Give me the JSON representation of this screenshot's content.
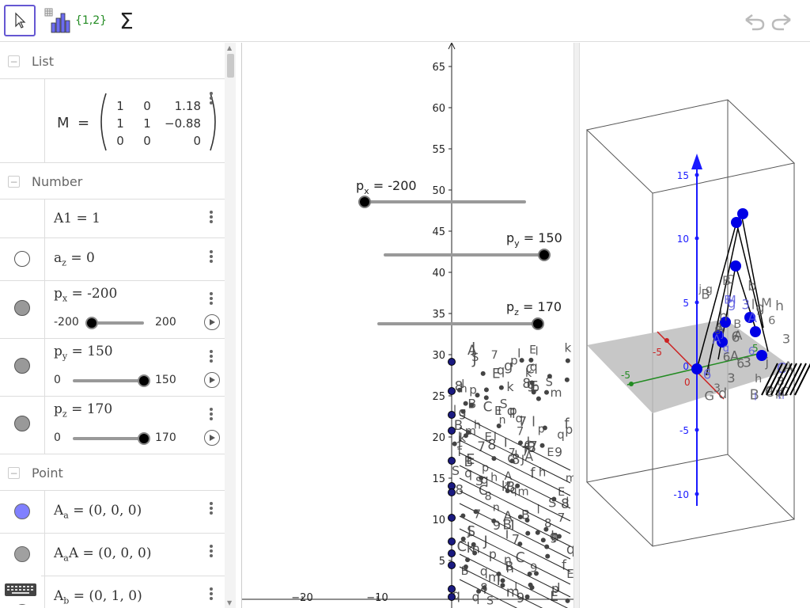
{
  "toolbar": {
    "tools": [
      {
        "name": "move-tool",
        "icon": "pointer-arrow-icon"
      },
      {
        "name": "statistics-tool",
        "icon": "bar-chart-icon"
      },
      {
        "name": "list-tool",
        "label": "{1,2}"
      },
      {
        "name": "sum-tool",
        "label": "Σ"
      }
    ],
    "undo_icon": "undo-icon",
    "redo_icon": "redo-icon"
  },
  "algebra": {
    "categories": {
      "list": "List",
      "number": "Number",
      "point": "Point"
    },
    "matrix": {
      "name": "M",
      "eq": "=",
      "rows": [
        [
          "1",
          "0",
          "1.18"
        ],
        [
          "1",
          "1",
          "−0.88"
        ],
        [
          "0",
          "0",
          "0"
        ]
      ]
    },
    "a1": "A1 = 1",
    "az": {
      "base": "a",
      "sub": "z",
      "rest": " = 0"
    },
    "sliders": [
      {
        "base": "p",
        "sub": "x",
        "value": " = -200",
        "min": "-200",
        "max": "200",
        "fraction": 0.0
      },
      {
        "base": "p",
        "sub": "y",
        "value": " = 150",
        "min": "0",
        "max": "150",
        "fraction": 1.0
      },
      {
        "base": "p",
        "sub": "z",
        "value": " = 170",
        "min": "0",
        "max": "170",
        "fraction": 1.0
      }
    ],
    "points": [
      {
        "base": "A",
        "sub": "a",
        "after": "",
        "value": " = (0, 0, 0)",
        "color": "#8080ff"
      },
      {
        "base": "A",
        "sub": "a",
        "after": "A",
        "value": " = (0, 0, 0)",
        "color": "#a0a0a0"
      },
      {
        "base": "A",
        "sub": "b",
        "after": "",
        "value": " = (0, 1, 0)",
        "color": "#a0a0a0"
      }
    ]
  },
  "graphics2d": {
    "y_ticks": [
      "65",
      "60",
      "55",
      "50",
      "45",
      "40",
      "35",
      "30",
      "25",
      "20",
      "15",
      "10",
      "5"
    ],
    "x_ticks": [
      "−20",
      "−10"
    ],
    "slider_labels": [
      {
        "base": "p",
        "sub": "x",
        "value": " = -200",
        "fraction": 0.0
      },
      {
        "base": "p",
        "sub": "y",
        "value": " = 150",
        "fraction": 1.0
      },
      {
        "base": "p",
        "sub": "z",
        "value": " = 170",
        "fraction": 1.0
      }
    ]
  },
  "graphics3d": {
    "z_ticks": [
      "15",
      "10",
      "5",
      "0",
      "-5",
      "-10"
    ],
    "x_tick": "-5",
    "y_tick": "-5",
    "y_tick_pos": "5",
    "origin_label": "0"
  }
}
